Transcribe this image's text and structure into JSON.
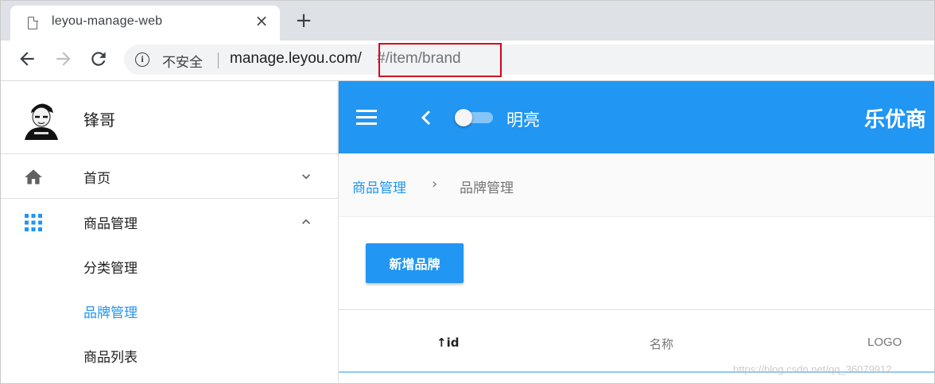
{
  "browser": {
    "tab_title": "leyou-manage-web",
    "tab_close": "×",
    "new_tab": "+",
    "security_label": "不安全",
    "url_host": "manage.leyou.com/",
    "url_path": "#/item/brand"
  },
  "sidebar": {
    "user_name": "锋哥",
    "items": [
      {
        "label": "首页",
        "icon": "home-icon",
        "expanded": false
      },
      {
        "label": "商品管理",
        "icon": "apps-grid-icon",
        "expanded": true
      }
    ],
    "sub_items": [
      {
        "label": "分类管理",
        "active": false
      },
      {
        "label": "品牌管理",
        "active": true
      },
      {
        "label": "商品列表",
        "active": false
      }
    ]
  },
  "appbar": {
    "theme_label": "明亮",
    "title": "乐优商",
    "color": "#2196f3"
  },
  "breadcrumb": {
    "parent": "商品管理",
    "separator": "›",
    "current": "品牌管理"
  },
  "content": {
    "add_button": "新增品牌",
    "columns": [
      "↑id",
      "名称",
      "LOGO"
    ]
  },
  "watermark": "https://blog.csdn.net/qq_36079912"
}
